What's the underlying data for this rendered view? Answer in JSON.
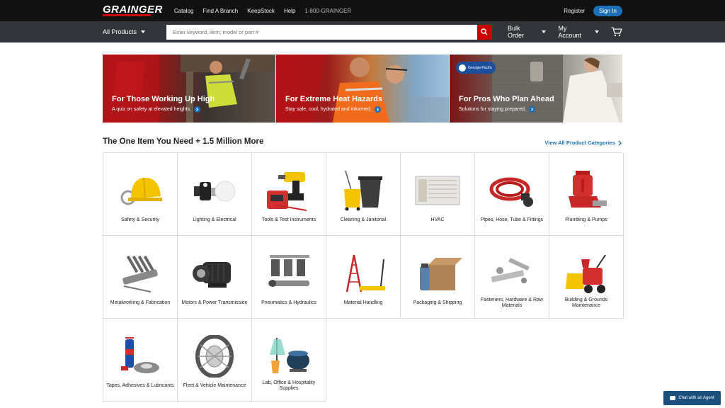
{
  "header": {
    "logo": "GRAINGER",
    "links": [
      "Catalog",
      "Find A Branch",
      "KeepStock",
      "Help"
    ],
    "phone": "1-800-GRAINGER",
    "register": "Register",
    "sign_in": "Sign In"
  },
  "nav": {
    "all_products": "All Products",
    "search_placeholder": "Enter keyword, item, model or part #",
    "bulk_order": "Bulk Order",
    "my_account": "My Account"
  },
  "banners": [
    {
      "title": "For Those Working Up High",
      "subtitle": "A quiz on safety at elevated heights."
    },
    {
      "title": "For Extreme Heat Hazards",
      "subtitle": "Stay safe, cool, hydrated and informed."
    },
    {
      "title": "For Pros Who Plan Ahead",
      "subtitle": "Solutions for staying prepared.",
      "badge": "Georgia-Pacific"
    }
  ],
  "section": {
    "title": "The One Item You Need + 1.5 Million More",
    "view_all": "View All Product Categories"
  },
  "categories": [
    {
      "label": "Safety & Security",
      "icon": "hard-hat-icon"
    },
    {
      "label": "Lighting & Electrical",
      "icon": "light-bulb-icon"
    },
    {
      "label": "Tools & Test Instruments",
      "icon": "drill-icon"
    },
    {
      "label": "Cleaning & Janitorial",
      "icon": "mop-bucket-icon"
    },
    {
      "label": "HVAC",
      "icon": "air-conditioner-icon"
    },
    {
      "label": "Pipes, Hose, Tube & Fittings",
      "icon": "hose-icon"
    },
    {
      "label": "Plumbing & Pumps",
      "icon": "pump-icon"
    },
    {
      "label": "Metalworking & Fabrication",
      "icon": "grinder-icon"
    },
    {
      "label": "Motors & Power Transmission",
      "icon": "motor-icon"
    },
    {
      "label": "Pneumatics & Hydraulics",
      "icon": "pneumatics-icon"
    },
    {
      "label": "Material Handling",
      "icon": "ladder-icon"
    },
    {
      "label": "Packaging & Shipping",
      "icon": "box-icon"
    },
    {
      "label": "Fasteners, Hardware & Raw Materials",
      "icon": "fastener-icon"
    },
    {
      "label": "Building & Grounds Maintenance",
      "icon": "snowblower-icon"
    },
    {
      "label": "Tapes, Adhesives & Lubricants",
      "icon": "tape-icon"
    },
    {
      "label": "Fleet & Vehicle Maintenance",
      "icon": "tire-chain-icon"
    },
    {
      "label": "Lab, Office & Hospitality Supplies",
      "icon": "lab-flask-icon"
    }
  ],
  "chat": "Chat with an Agent"
}
